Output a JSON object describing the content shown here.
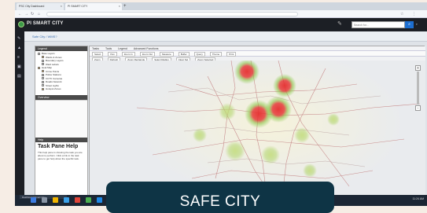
{
  "browser": {
    "tabs": [
      {
        "label": "PSC City Dashboard"
      },
      {
        "label": "PI SMART CITY"
      }
    ],
    "url": "",
    "new_tab_symbol": "+"
  },
  "app": {
    "title": "PI SMART CITY",
    "search_placeholder": "Search for...",
    "search_icon": "search-icon"
  },
  "breadcrumb": "Safe City / WMS?",
  "left_panel": {
    "legend_header": "Legend",
    "legend_items": [
      {
        "label": "Base Layers",
        "checked": false,
        "indent": 0
      },
      {
        "label": "Wards & Zones",
        "checked": true,
        "indent": 1
      },
      {
        "label": "Boundary Layers",
        "checked": false,
        "indent": 1
      },
      {
        "label": "Ward Labels",
        "checked": false,
        "indent": 1
      },
      {
        "label": "Heat Map",
        "checked": true,
        "indent": 0
      },
      {
        "label": "Crime Points",
        "checked": true,
        "indent": 1
      },
      {
        "label": "Police Stations",
        "checked": false,
        "indent": 1
      },
      {
        "label": "CCTV Cameras",
        "checked": false,
        "indent": 1
      },
      {
        "label": "Roads Network",
        "checked": false,
        "indent": 1
      },
      {
        "label": "Street Lights",
        "checked": false,
        "indent": 1
      },
      {
        "label": "Hotspot Zones",
        "checked": true,
        "indent": 1
      }
    ],
    "overview_header": "Overview",
    "help_header": "Help",
    "help_title": "Task Pane Help",
    "help_text": "This help pane is showing the task you are about to perform. Click a link in the task pane to get help about the specific task."
  },
  "map": {
    "toolbar_top": [
      "Tasks",
      "Tools",
      "Legend",
      "Advanced Functions"
    ],
    "toolbar_tools": [
      "Select",
      "Pan",
      "Zoom In",
      "Zoom Out",
      "Measure",
      "Buffer",
      "Query",
      "Theme",
      "Print"
    ],
    "toolbar_row3": [
      "Zoom",
      "Refresh",
      "Zoom Rectangle",
      "Select Radius",
      "Clear Sel",
      "Zoom Selected"
    ],
    "zoom_in": "+",
    "zoom_out": "-"
  },
  "taskbar": {
    "app_label": "Dashboard Smart City",
    "clock": "11:24 AM"
  },
  "caption": "SAFE CITY",
  "colors": {
    "app_header": "#1c1f25",
    "heat_hot": "#e53030",
    "heat_warm": "#8dc84c",
    "caption_bg": "#0e3445",
    "search_button": "#1d6fd1"
  }
}
